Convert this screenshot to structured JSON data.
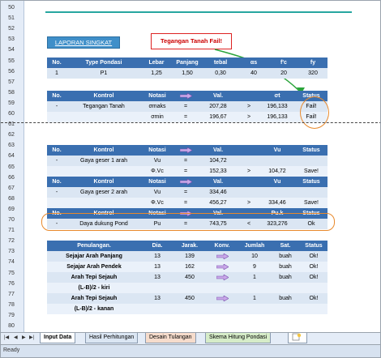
{
  "row_numbers": [
    "50",
    "51",
    "52",
    "53",
    "54",
    "55",
    "56",
    "57",
    "58",
    "59",
    "60",
    "61",
    "62",
    "63",
    "64",
    "65",
    "66",
    "67",
    "68",
    "69",
    "70",
    "71",
    "72",
    "73",
    "74",
    "75",
    "76",
    "77",
    "78",
    "79",
    "80"
  ],
  "section_title": "LAPORAN SINGKAT",
  "callout": "Tegangan Tanah Fail!",
  "t1": {
    "headers": [
      "No.",
      "Type Pondasi",
      "Lebar",
      "Panjang",
      "tebal",
      "αs",
      "f'c",
      "fy"
    ],
    "row": [
      "1",
      "P1",
      "1,25",
      "1,50",
      "0,30",
      "40",
      "20",
      "320"
    ]
  },
  "t2": {
    "headers": [
      "No.",
      "Kontrol",
      "Notasi",
      "",
      "Val.",
      "",
      "σt",
      "Status"
    ],
    "rows": [
      [
        "-",
        "Tegangan Tanah",
        "σmaks",
        "=",
        "207,28",
        ">",
        "196,133",
        "Fail!"
      ],
      [
        "",
        "",
        "σmin",
        "=",
        "196,67",
        ">",
        "196,133",
        "Fail!"
      ]
    ]
  },
  "t3": {
    "headers": [
      "No.",
      "Kontrol",
      "Notasi",
      "",
      "Val.",
      "",
      "Vu",
      "Status"
    ],
    "rows": [
      [
        "-",
        "Gaya geser 1 arah",
        "Vu",
        "=",
        "104,72",
        "",
        "",
        ""
      ],
      [
        "",
        "",
        "Φ.Vc",
        "=",
        "152,33",
        ">",
        "104,72",
        "Save!"
      ]
    ],
    "sub_headers": [
      "No.",
      "Kontrol",
      "Notasi",
      "",
      "Val.",
      "",
      "Vu",
      "Status"
    ],
    "sub_rows": [
      [
        "-",
        "Gaya geser 2 arah",
        "Vu",
        "=",
        "334,46",
        "",
        "",
        ""
      ],
      [
        "",
        "",
        "Φ.Vc",
        "=",
        "456,27",
        ">",
        "334,46",
        "Save!"
      ]
    ],
    "pu_headers": [
      "No.",
      "Kontrol",
      "Notasi",
      "",
      "Val.",
      "",
      "Pu.k",
      "Status"
    ],
    "pu_row": [
      "-",
      "Daya dukung Pond",
      "Pu",
      "=",
      "743,75",
      "<",
      "323,276",
      "Ok"
    ]
  },
  "t4": {
    "headers": [
      "Penulangan.",
      "Dia.",
      "Jarak.",
      "Konv.",
      "Jumlah",
      "Sat.",
      "Status"
    ],
    "rows": [
      [
        "Sejajar Arah Panjang",
        "13",
        "139",
        "",
        "10",
        "buah",
        "Ok!"
      ],
      [
        "Sejajar Arah Pendek",
        "13",
        "162",
        "",
        "9",
        "buah",
        "Ok!"
      ],
      [
        "Arah Tepi Sejauh",
        "13",
        "450",
        "",
        "1",
        "buah",
        "Ok!"
      ],
      [
        "(L-B)/2 - kiri",
        "",
        "",
        "",
        "",
        "",
        ""
      ],
      [
        "Arah Tepi Sejauh",
        "13",
        "450",
        "",
        "1",
        "buah",
        "Ok!"
      ],
      [
        "(L-B)/2 - kanan",
        "",
        "",
        "",
        "",
        "",
        ""
      ]
    ]
  },
  "tabs": [
    "Input Data",
    "Hasil Perhitungan",
    "Desain Tulangan",
    "Skema Hitung Pondasi"
  ],
  "status": "Ready",
  "colors": {
    "header": "#3a6fb0",
    "row": "#dbe6f3",
    "accent": "#e8892c",
    "fail": "#c00000"
  }
}
